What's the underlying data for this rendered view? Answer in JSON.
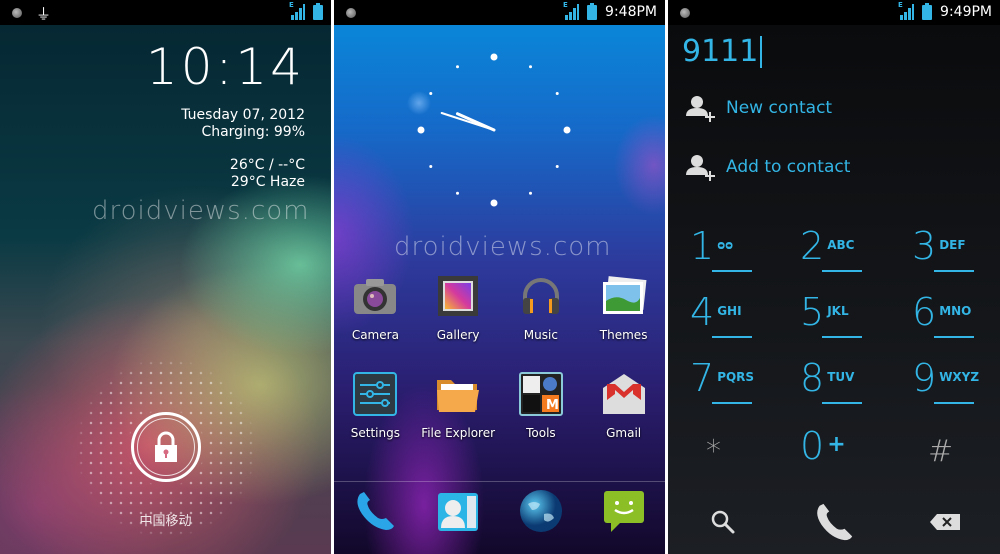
{
  "watermark": "droidviews.com",
  "lock_screen": {
    "status": {
      "left_icons": [
        "notification-dot-icon",
        "usb-icon"
      ],
      "right_icons": [
        "signal-e-icon",
        "battery-icon"
      ]
    },
    "clock": "10:14",
    "date": "Tuesday 07, 2012",
    "charging": "Charging: 99%",
    "weather_range": "26°C / --°C",
    "weather_now": "29°C  Haze",
    "unlock_icon": "lock-icon",
    "carrier": "中国移动",
    "accent": "#ffffff"
  },
  "home_screen": {
    "status": {
      "time": "9:48PM"
    },
    "clock_widget": {
      "hour": 9,
      "minute": 48
    },
    "apps": [
      {
        "label": "Camera",
        "icon": "camera-icon"
      },
      {
        "label": "Gallery",
        "icon": "gallery-icon"
      },
      {
        "label": "Music",
        "icon": "headphones-icon"
      },
      {
        "label": "Themes",
        "icon": "themes-icon"
      },
      {
        "label": "Settings",
        "icon": "settings-icon"
      },
      {
        "label": "File Explorer",
        "icon": "folder-icon"
      },
      {
        "label": "Tools",
        "icon": "tools-folder-icon"
      },
      {
        "label": "Gmail",
        "icon": "gmail-icon"
      }
    ],
    "dock": [
      "phone-icon",
      "contacts-icon",
      "browser-globe-icon",
      "messaging-icon"
    ]
  },
  "dialer": {
    "status": {
      "time": "9:49PM"
    },
    "number": "9111",
    "actions": [
      {
        "label": "New contact",
        "icon": "add-person-icon"
      },
      {
        "label": "Add to contact",
        "icon": "add-person-icon"
      }
    ],
    "keys": [
      {
        "digit": "1",
        "letters": "ᴑᴑ"
      },
      {
        "digit": "2",
        "letters": "ABC"
      },
      {
        "digit": "3",
        "letters": "DEF"
      },
      {
        "digit": "4",
        "letters": "GHI"
      },
      {
        "digit": "5",
        "letters": "JKL"
      },
      {
        "digit": "6",
        "letters": "MNO"
      },
      {
        "digit": "7",
        "letters": "PQRS"
      },
      {
        "digit": "8",
        "letters": "TUV"
      },
      {
        "digit": "9",
        "letters": "WXYZ"
      },
      {
        "digit": "*",
        "letters": ""
      },
      {
        "digit": "0",
        "letters": "+"
      },
      {
        "digit": "#",
        "letters": ""
      }
    ],
    "bottom": [
      "search-icon",
      "call-icon",
      "backspace-icon"
    ],
    "accent": "#33b5e5"
  }
}
